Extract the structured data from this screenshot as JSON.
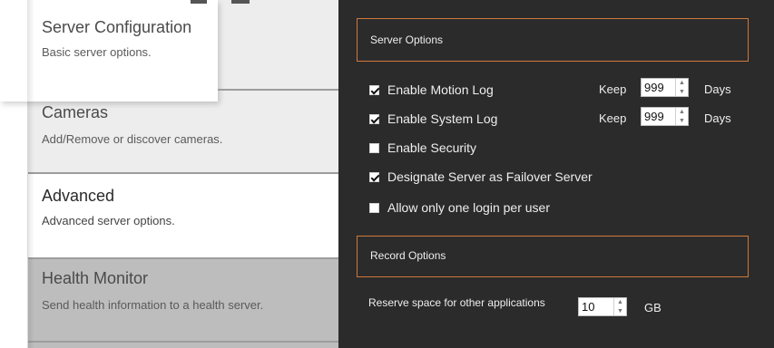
{
  "sidebar": {
    "items": [
      {
        "title": "Server Configuration",
        "subtitle": "Basic server options."
      },
      {
        "title": "Cameras",
        "subtitle": "Add/Remove or discover cameras."
      },
      {
        "title": "Advanced",
        "subtitle": "Advanced server options."
      },
      {
        "title": "Health Monitor",
        "subtitle": "Send health information to a health server."
      }
    ],
    "active_index": 2
  },
  "server_options": {
    "title": "Server Options",
    "options": [
      {
        "label": "Enable Motion Log",
        "checked": true
      },
      {
        "label": "Enable System Log",
        "checked": true
      },
      {
        "label": "Enable Security",
        "checked": false
      },
      {
        "label": "Designate Server as Failover Server",
        "checked": true
      },
      {
        "label": "Allow only one login per user",
        "checked": false
      }
    ],
    "motion_log_keep": {
      "keep_label": "Keep",
      "value": "999",
      "unit": "Days"
    },
    "system_log_keep": {
      "keep_label": "Keep",
      "value": "999",
      "unit": "Days"
    }
  },
  "record_options": {
    "title": "Record Options",
    "reserve_label": "Reserve space for other applications",
    "reserve_value": "10",
    "reserve_unit": "GB"
  },
  "spinner_icons": {
    "up": "▲",
    "down": "▼"
  },
  "colors": {
    "accent_border": "#d0783a",
    "panel_bg": "#2b2b2b",
    "sidebar_item_bg": "#bdbdbd"
  }
}
